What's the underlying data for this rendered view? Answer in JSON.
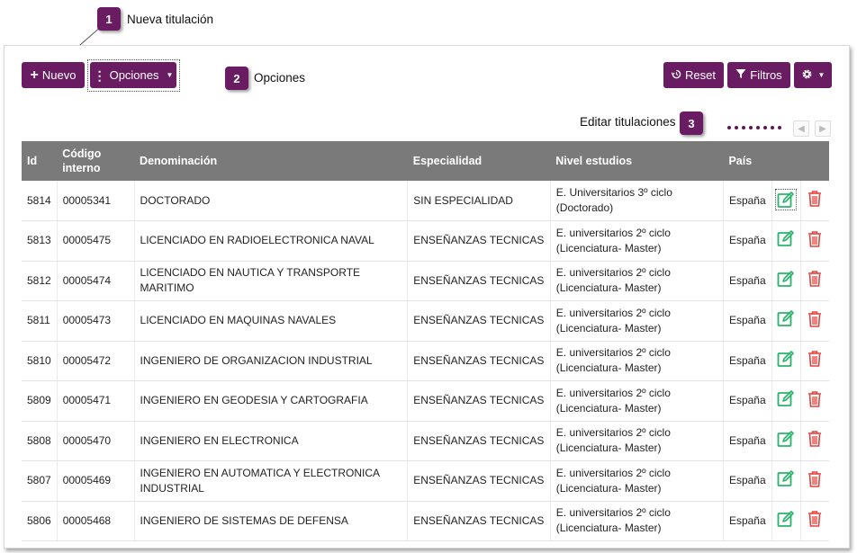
{
  "toolbar": {
    "new_label": "Nuevo",
    "options_label": "Opciones",
    "reset_label": "Reset",
    "filters_label": "Filtros"
  },
  "callouts": [
    {
      "number": "1",
      "text": "Nueva titulación"
    },
    {
      "number": "2",
      "text": "Opciones"
    },
    {
      "number": "3",
      "text": "Editar titulaciones"
    }
  ],
  "table": {
    "headers": {
      "id": "Id",
      "code_line1": "Código",
      "code_line2": "interno",
      "name": "Denominación",
      "specialty": "Especialidad",
      "level": "Nivel estudios",
      "country": "País"
    },
    "rows": [
      {
        "id": "5814",
        "code": "00005341",
        "name": "DOCTORADO",
        "specialty": "SIN ESPECIALIDAD",
        "level1": "E. Universitarios 3º ciclo",
        "level2": "(Doctorado)",
        "country": "España"
      },
      {
        "id": "5813",
        "code": "00005475",
        "name": "LICENCIADO EN RADIOELECTRONICA NAVAL",
        "specialty": "ENSEÑANZAS TECNICAS",
        "level1": "E. universitarios 2º ciclo",
        "level2": "(Licenciatura- Master)",
        "country": "España"
      },
      {
        "id": "5812",
        "code": "00005474",
        "name": "LICENCIADO EN NAUTICA Y TRANSPORTE MARITIMO",
        "specialty": "ENSEÑANZAS TECNICAS",
        "level1": "E. universitarios 2º ciclo",
        "level2": "(Licenciatura- Master)",
        "country": "España"
      },
      {
        "id": "5811",
        "code": "00005473",
        "name": "LICENCIADO EN MAQUINAS NAVALES",
        "specialty": "ENSEÑANZAS TECNICAS",
        "level1": "E. universitarios 2º ciclo",
        "level2": "(Licenciatura- Master)",
        "country": "España"
      },
      {
        "id": "5810",
        "code": "00005472",
        "name": "INGENIERO DE ORGANIZACION INDUSTRIAL",
        "specialty": "ENSEÑANZAS TECNICAS",
        "level1": "E. universitarios 2º ciclo",
        "level2": "(Licenciatura- Master)",
        "country": "España"
      },
      {
        "id": "5809",
        "code": "00005471",
        "name": "INGENIERO EN GEODESIA Y CARTOGRAFIA",
        "specialty": "ENSEÑANZAS TECNICAS",
        "level1": "E. universitarios 2º ciclo",
        "level2": "(Licenciatura- Master)",
        "country": "España"
      },
      {
        "id": "5808",
        "code": "00005470",
        "name": "INGENIERO EN ELECTRONICA",
        "specialty": "ENSEÑANZAS TECNICAS",
        "level1": "E. universitarios 2º ciclo",
        "level2": "(Licenciatura- Master)",
        "country": "España"
      },
      {
        "id": "5807",
        "code": "00005469",
        "name": "INGENIERO EN AUTOMATICA Y ELECTRONICA INDUSTRIAL",
        "specialty": "ENSEÑANZAS TECNICAS",
        "level1": "E. universitarios 2º ciclo",
        "level2": "(Licenciatura- Master)",
        "country": "España"
      },
      {
        "id": "5806",
        "code": "00005468",
        "name": "INGENIERO DE SISTEMAS DE DEFENSA",
        "specialty": "ENSEÑANZAS TECNICAS",
        "level1": "E. universitarios 2º ciclo",
        "level2": "(Licenciatura- Master)",
        "country": "España"
      }
    ]
  },
  "icons": {
    "new": "plus-icon",
    "options": "vertical-ellipsis-icon",
    "reset": "history-icon",
    "filters": "funnel-icon",
    "settings": "gear-icon",
    "edit": "edit-pencil-icon",
    "delete": "trash-icon",
    "pager_prev": "chevron-left-icon",
    "pager_next": "chevron-right-icon"
  },
  "colors": {
    "accent": "#6a1c63",
    "header_bg": "#7a7a7a",
    "edit": "#27b46a",
    "delete": "#e0433d"
  }
}
